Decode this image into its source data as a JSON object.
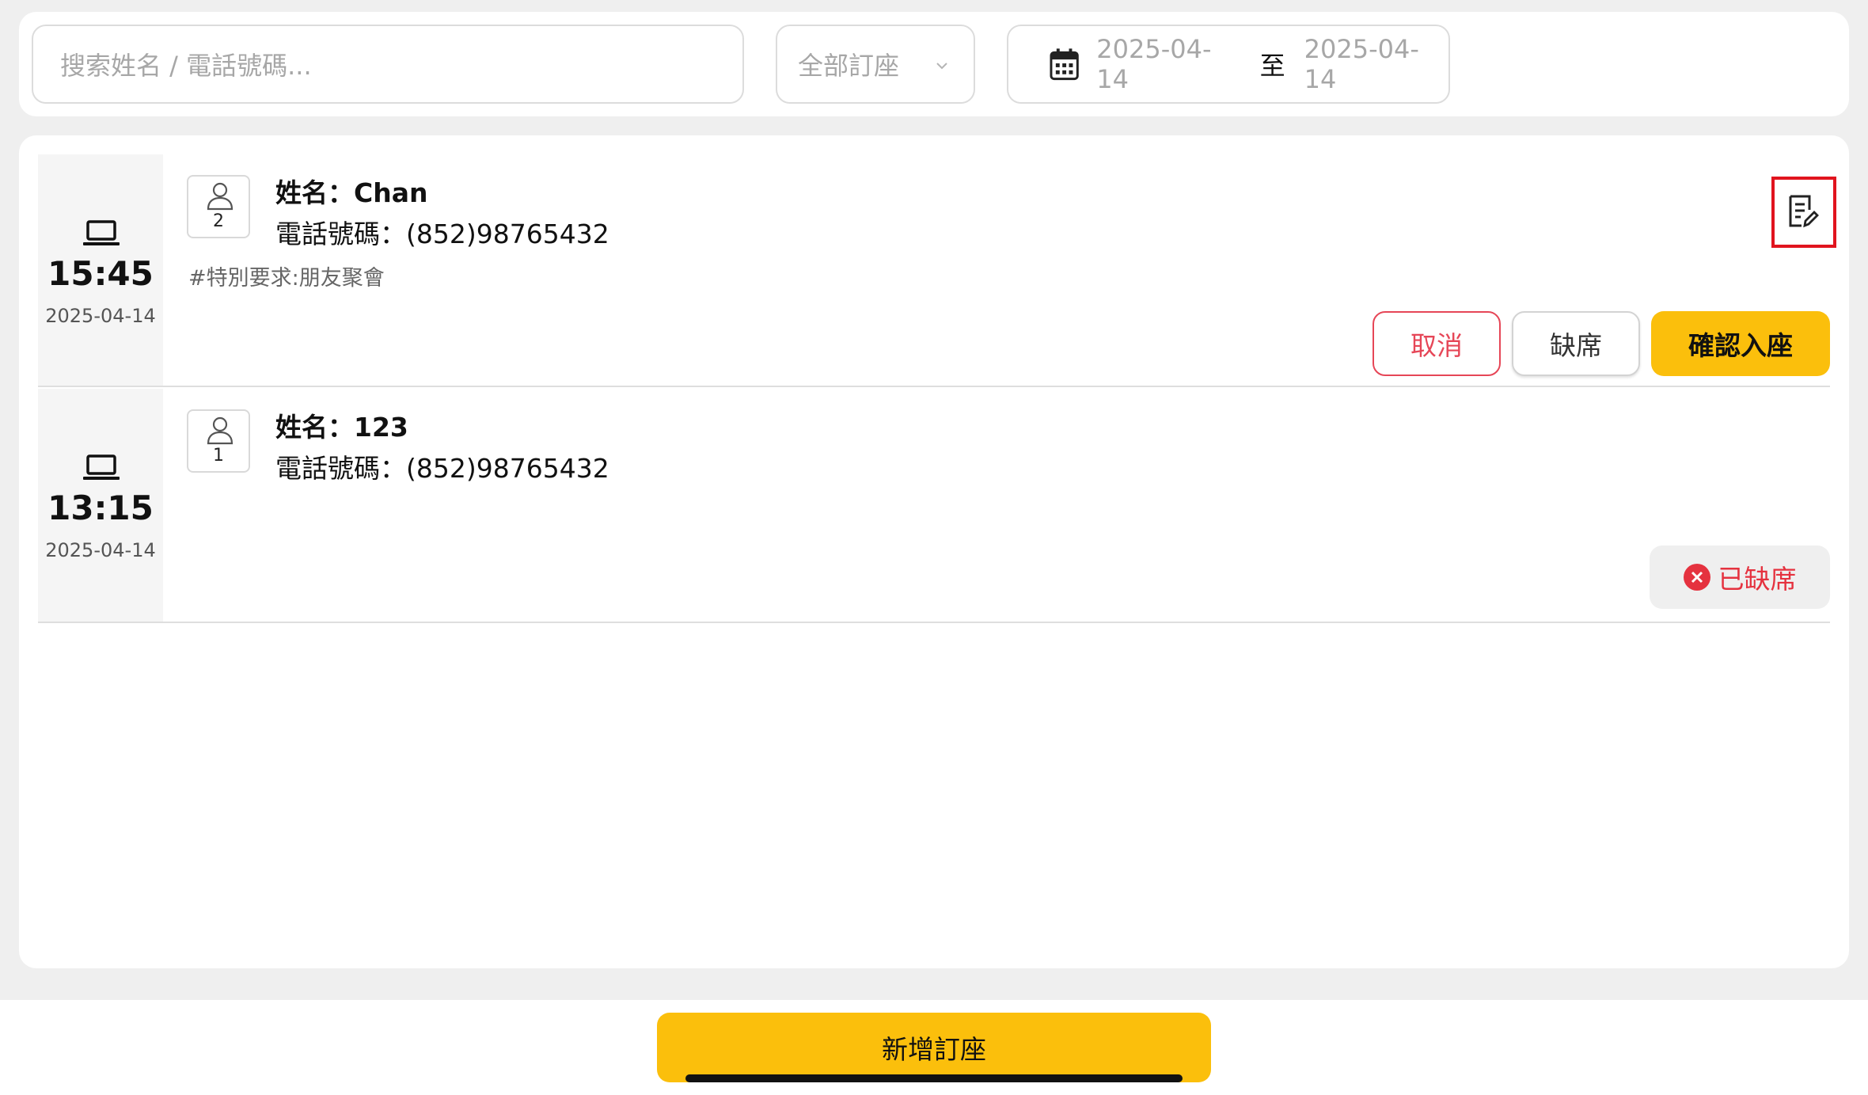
{
  "filters": {
    "search_placeholder": "搜索姓名 / 電話號碼...",
    "type_select": "全部訂座",
    "date_from": "2025-04-14",
    "date_separator": "至",
    "date_to": "2025-04-14"
  },
  "reservations": [
    {
      "source_icon": "laptop-icon",
      "time": "15:45",
      "date": "2025-04-14",
      "guests": "2",
      "name": "姓名：Chan",
      "phone": "電話號碼：(852)98765432",
      "remark": "#特別要求:朋友聚會",
      "actions": {
        "cancel": "取消",
        "no_show": "缺席",
        "confirm": "確認入座"
      }
    },
    {
      "source_icon": "laptop-icon",
      "time": "13:15",
      "date": "2025-04-14",
      "guests": "1",
      "name": "姓名：123",
      "phone": "電話號碼：(852)98765432",
      "status": "已缺席"
    }
  ],
  "footer": {
    "add_button": "新增訂座"
  },
  "colors": {
    "accent": "#fbbf0c",
    "danger": "#e64657",
    "highlight_border": "#e1141e"
  }
}
